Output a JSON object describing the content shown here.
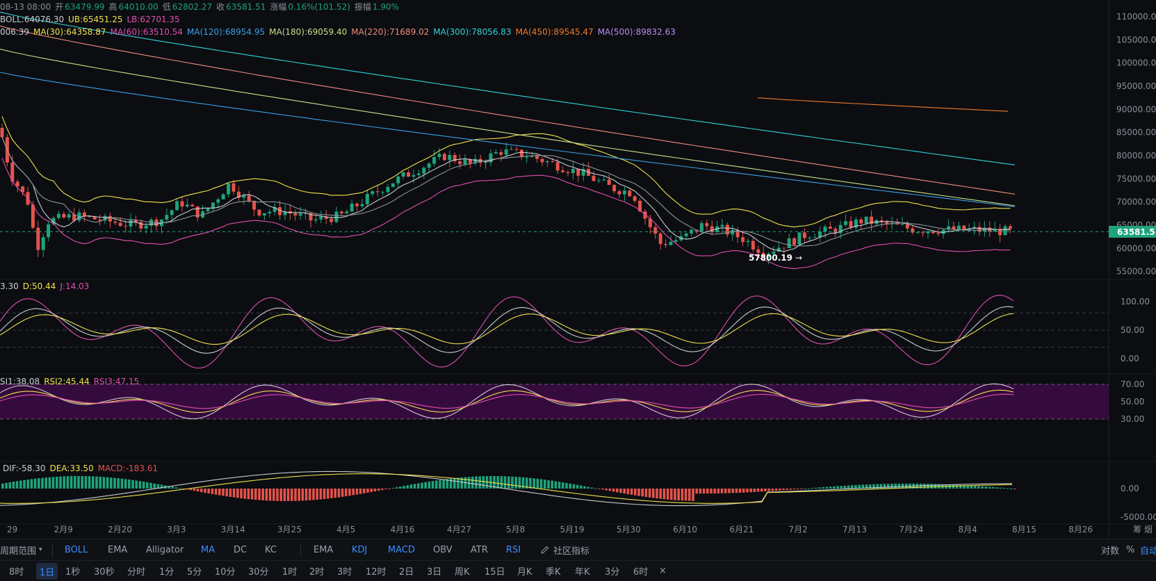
{
  "header": {
    "date": "08-13 08:00",
    "open_label": "开",
    "open": "63479.99",
    "high_label": "高",
    "high": "64010.00",
    "low_label": "低",
    "low": "62802.27",
    "close_label": "收",
    "close": "63581.51",
    "change_label": "涨幅",
    "change": "0.16%(101.52)",
    "amp_label": "振幅",
    "amp": "1.90%"
  },
  "boll_legend": [
    {
      "text": "BOLL:64076.30",
      "color": "#c9ccd2"
    },
    {
      "text": "UB:65451.25",
      "color": "#f2e14b"
    },
    {
      "text": "LB:62701.35",
      "color": "#e24fb0"
    }
  ],
  "ma_legend": [
    {
      "text": "006.39",
      "color": "#c9ccd2"
    },
    {
      "text": "MA(30):64358.87",
      "color": "#f2e14b"
    },
    {
      "text": "MA(60):63510.54",
      "color": "#e24fb0"
    },
    {
      "text": "MA(120):68954.95",
      "color": "#3aa0e8"
    },
    {
      "text": "MA(180):69059.40",
      "color": "#c7e08a"
    },
    {
      "text": "MA(220):71689.02",
      "color": "#f08c7c"
    },
    {
      "text": "MA(300):78056.83",
      "color": "#2fd3d8"
    },
    {
      "text": "MA(450):89545.47",
      "color": "#f07a2a"
    },
    {
      "text": "MA(500):89832.63",
      "color": "#b98cf2"
    }
  ],
  "kdj_legend": [
    {
      "text": "3.30",
      "color": "#c9ccd2"
    },
    {
      "text": "D:50.44",
      "color": "#f2e14b"
    },
    {
      "text": "J:14.03",
      "color": "#e24fb0"
    }
  ],
  "rsi_legend": [
    {
      "text": "SI1:38.08",
      "color": "#c9ccd2"
    },
    {
      "text": "RSI2:45.44",
      "color": "#f2e14b"
    },
    {
      "text": "RSI3:47.15",
      "color": "#e24fb0"
    }
  ],
  "macd_legend": [
    {
      "text": "DIF:-58.30",
      "color": "#c9ccd2"
    },
    {
      "text": "DEA:33.50",
      "color": "#f2e14b"
    },
    {
      "text": "MACD:-183.61",
      "color": "#e5534b"
    }
  ],
  "price_axis": [
    "110000.00",
    "105000.00",
    "100000.00",
    "95000.00",
    "90000.00",
    "85000.00",
    "80000.00",
    "75000.00",
    "70000.00",
    "65000.00",
    "60000.00",
    "55000.00"
  ],
  "kdj_axis": [
    "100.00",
    "50.00",
    "0.00"
  ],
  "rsi_axis": [
    "70.00",
    "50.00",
    "30.00"
  ],
  "macd_axis": [
    "0.00",
    "-5000.00"
  ],
  "date_axis": [
    "29",
    "2月9",
    "2月20",
    "3月3",
    "3月14",
    "3月25",
    "4月5",
    "4月16",
    "4月27",
    "5月8",
    "5月19",
    "5月30",
    "6月10",
    "6月21",
    "7月2",
    "7月13",
    "7月24",
    "8月4",
    "8月15",
    "8月26"
  ],
  "date_axis_right": "筹  烟",
  "current_price": "63581.51",
  "low_marker": "57800.19",
  "colors": {
    "up": "#1fa37c",
    "down": "#e5534b",
    "background": "#0b0d11",
    "accent": "#3a8dff"
  },
  "indicator_bar": {
    "range_label": "周期范围",
    "main": [
      {
        "label": "BOLL",
        "active": true
      },
      {
        "label": "EMA",
        "active": false
      },
      {
        "label": "Alligator",
        "active": false
      },
      {
        "label": "MA",
        "active": true
      },
      {
        "label": "DC",
        "active": false
      },
      {
        "label": "KC",
        "active": false
      }
    ],
    "sub": [
      {
        "label": "EMA",
        "active": false
      },
      {
        "label": "KDJ",
        "active": true
      },
      {
        "label": "MACD",
        "active": true
      },
      {
        "label": "OBV",
        "active": false
      },
      {
        "label": "ATR",
        "active": false
      },
      {
        "label": "RSI",
        "active": true
      }
    ],
    "community": "社区指标",
    "scale_log": "对数",
    "scale_pct": "%",
    "scale_auto": "自动"
  },
  "interval_bar": {
    "items": [
      "8时",
      "1日",
      "1秒",
      "30秒",
      "分时",
      "1分",
      "5分",
      "10分",
      "30分",
      "1时",
      "2时",
      "3时",
      "12时",
      "2日",
      "3日",
      "周K",
      "15日",
      "月K",
      "季K",
      "年K",
      "3分",
      "6时"
    ],
    "selected": "1日",
    "close_icon": "×"
  }
}
